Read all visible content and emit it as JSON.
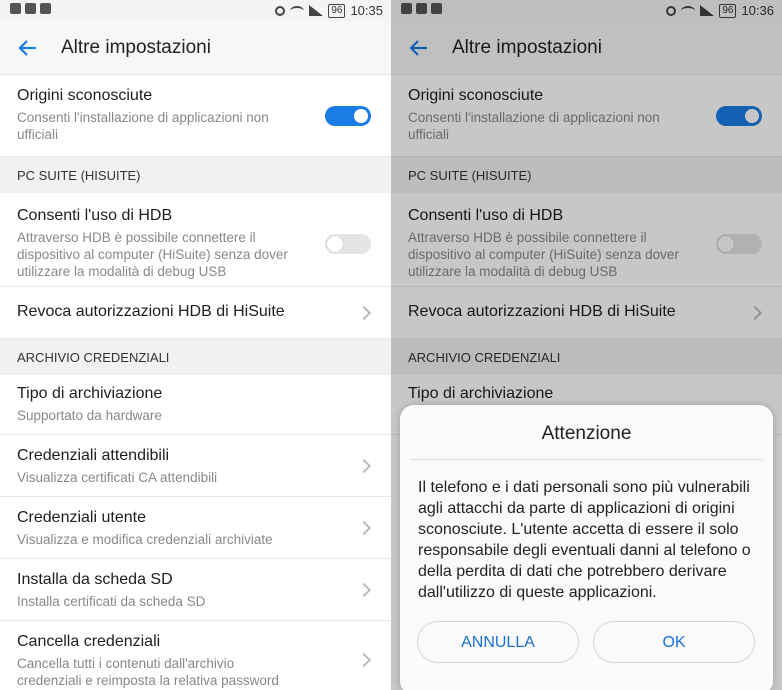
{
  "left": {
    "status": {
      "time": "10:35",
      "battery": "96"
    },
    "header": {
      "title": "Altre impostazioni"
    },
    "unknown_sources": {
      "title": "Origini sconosciute",
      "subtitle": "Consenti l'installazione di applicazioni non ufficiali",
      "enabled": true
    },
    "pc_suite": {
      "header": "PC SUITE (HISUITE)",
      "hdb_title": "Consenti l'uso di HDB",
      "hdb_subtitle": "Attraverso HDB è possibile connettere il dispositivo al computer (HiSuite) senza dover utilizzare la modalità di debug USB",
      "hdb_enabled": false,
      "revoke": "Revoca autorizzazioni HDB di HiSuite"
    },
    "credentials": {
      "header": "ARCHIVIO CREDENZIALI",
      "items": [
        {
          "title": "Tipo di archiviazione",
          "subtitle": "Supportato da hardware"
        },
        {
          "title": "Credenziali attendibili",
          "subtitle": "Visualizza certificati CA attendibili"
        },
        {
          "title": "Credenziali utente",
          "subtitle": "Visualizza e modifica credenziali archiviate"
        },
        {
          "title": "Installa da scheda SD",
          "subtitle": "Installa certificati da scheda SD"
        },
        {
          "title": "Cancella credenziali",
          "subtitle": "Cancella tutti i contenuti dall'archivio credenziali e reimposta la relativa password"
        }
      ]
    }
  },
  "right": {
    "status": {
      "time": "10:36",
      "battery": "96"
    },
    "header": {
      "title": "Altre impostazioni"
    },
    "unknown_sources": {
      "title": "Origini sconosciute",
      "subtitle": "Consenti l'installazione di applicazioni non ufficiali",
      "enabled": true
    },
    "pc_suite": {
      "header": "PC SUITE (HISUITE)",
      "hdb_title": "Consenti l'uso di HDB",
      "hdb_subtitle": "Attraverso HDB è possibile connettere il dispositivo al computer (HiSuite) senza dover utilizzare la modalità di debug USB",
      "hdb_enabled": false,
      "revoke": "Revoca autorizzazioni HDB di HiSuite"
    },
    "credentials": {
      "header": "ARCHIVIO CREDENZIALI",
      "items": [
        {
          "title": "Tipo di archiviazione"
        }
      ]
    },
    "dialog": {
      "title": "Attenzione",
      "message": "Il telefono e i dati personali sono più vulnerabili agli attacchi da parte di applicazioni di origini sconosciute. L'utente accetta di essere il solo responsabile degli eventuali danni al telefono o della perdita di dati che potrebbero derivare dall'utilizzo di queste applicazioni.",
      "cancel_label": "ANNULLA",
      "ok_label": "OK"
    }
  },
  "colors": {
    "accent": "#1a7de6",
    "section_bg": "#f1f1f1"
  }
}
